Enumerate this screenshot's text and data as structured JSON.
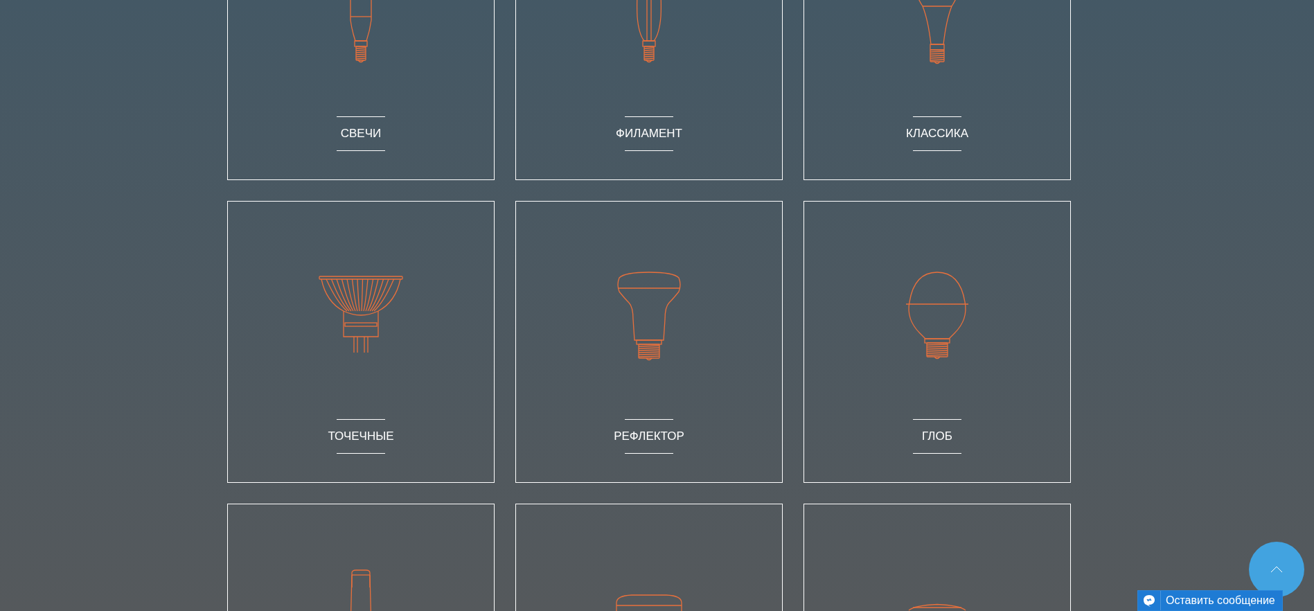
{
  "cards": [
    {
      "kind": "candle",
      "label": "СВЕЧИ"
    },
    {
      "kind": "filament",
      "label": "ФИЛАМЕНТ"
    },
    {
      "kind": "classic",
      "label": "КЛАССИКА"
    },
    {
      "kind": "spot",
      "label": "ТОЧЕЧНЫЕ"
    },
    {
      "kind": "reflector",
      "label": "РЕФЛЕКТОР"
    },
    {
      "kind": "globe",
      "label": "ГЛОБ"
    },
    {
      "kind": "tube"
    },
    {
      "kind": "panel"
    },
    {
      "kind": "dome"
    }
  ],
  "chat_button": {
    "label": "Оставить сообщение"
  }
}
